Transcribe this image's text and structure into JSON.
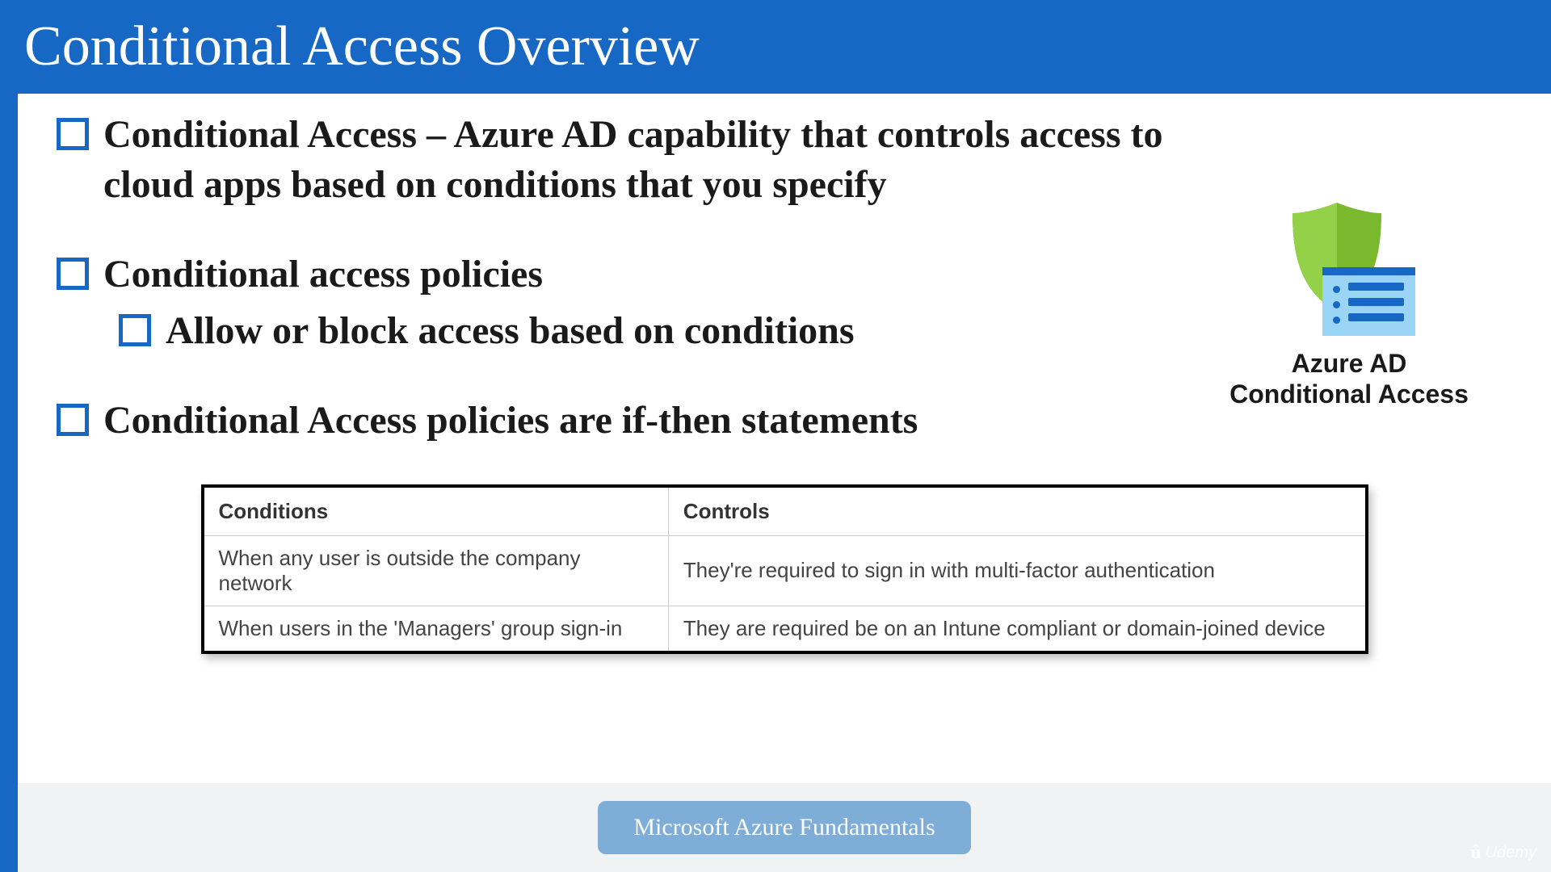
{
  "title": "Conditional Access Overview",
  "bullets": {
    "b1": "Conditional Access – Azure AD capability that controls access to cloud apps based on conditions that you specify",
    "b2": "Conditional access policies",
    "b2a": "Allow or block access based on conditions",
    "b3": "Conditional Access policies are if-then statements"
  },
  "graphic_label_line1": "Azure AD",
  "graphic_label_line2": "Conditional Access",
  "table": {
    "header_conditions": "Conditions",
    "header_controls": "Controls",
    "row1_condition": "When any user is outside the company network",
    "row1_control": "They're required to sign in with multi-factor authentication",
    "row2_condition": "When users in the 'Managers' group sign-in",
    "row2_control": "They are required be on an Intune compliant or domain-joined device"
  },
  "footer": "Microsoft Azure Fundamentals",
  "watermark": "Udemy"
}
